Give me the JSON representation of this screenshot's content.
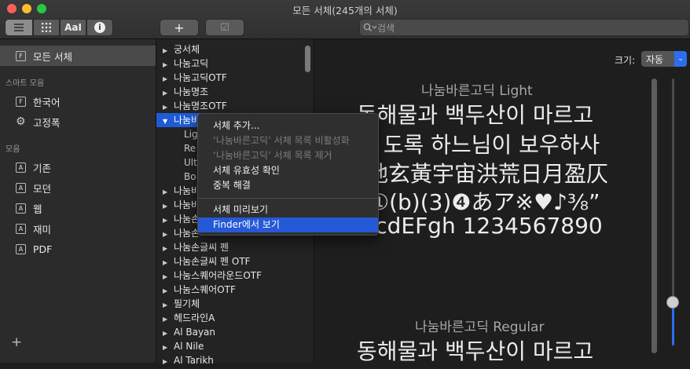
{
  "window": {
    "title": "모든 서체(245개의 서체)"
  },
  "toolbar": {
    "aa_label": "AaI",
    "add_label": "+",
    "check_label": "☑",
    "search_placeholder": "검색"
  },
  "sidebar": {
    "all_fonts": "모든 서체",
    "smart_header": "스마트 모음",
    "smart": [
      "한국어",
      "고정폭"
    ],
    "collections_header": "모음",
    "collections": [
      "기존",
      "모던",
      "웹",
      "재미",
      "PDF"
    ],
    "add_label": "+"
  },
  "font_list": {
    "before": [
      "궁서체",
      "나눔고딕",
      "나눔고딕OTF",
      "나눔명조",
      "나눔명조OTF"
    ],
    "selected": "나눔바",
    "subs": [
      "Lig",
      "Re",
      "Ult",
      "Bo"
    ],
    "after_partial": [
      "나눔바",
      "나눔바",
      "나눔손",
      "나눔손"
    ],
    "after": [
      "나눔손글씨 펜",
      "나눔손글씨 펜 OTF",
      "나눔스퀘어라운드OTF",
      "나눔스퀘어OTF",
      "필기체",
      "헤드라인A",
      "Al Bayan",
      "Al Nile",
      "Al Tarikh"
    ]
  },
  "context_menu": {
    "add": "서체 추가...",
    "disable": "‘나눔바른고딕’ 서체 목록 비활성화",
    "remove": "‘나눔바른고딕’ 서체 목록 제거",
    "validate": "서체 유효성 확인",
    "resolve": "중복 해결",
    "preview": "서체 미리보기",
    "finder": "Finder에서 보기"
  },
  "preview": {
    "size_label": "크기:",
    "size_value": "자동",
    "light_name": "나눔바른고딕 Light",
    "line1": "동해물과 백두산이 마르고",
    "line2": "ㅏ도록 하느님이 보우하사",
    "line3": "地玄黃宇宙洪荒日月盈仄",
    "line4": "①(b)(3)❹あア※♥♪⅜”",
    "line5": "BcdEFgh 1234567890",
    "regular_name": "나눔바른고딕 Regular",
    "line6": "동해물과 백두산이 마르고"
  },
  "colors": {
    "accent": "#2559d6",
    "background": "#1e1e1e"
  }
}
